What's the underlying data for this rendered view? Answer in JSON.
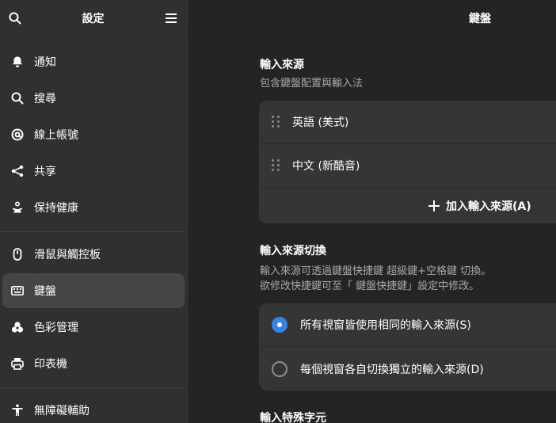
{
  "sidebar": {
    "title": "設定",
    "items": [
      {
        "label": "通知",
        "icon": "bell-icon"
      },
      {
        "label": "搜尋",
        "icon": "search-icon"
      },
      {
        "label": "線上帳號",
        "icon": "at-icon"
      },
      {
        "label": "共享",
        "icon": "share-icon"
      },
      {
        "label": "保持健康",
        "icon": "wellbeing-icon"
      },
      {
        "label": "滑鼠與觸控板",
        "icon": "mouse-icon"
      },
      {
        "label": "鍵盤",
        "icon": "keyboard-icon",
        "selected": true
      },
      {
        "label": "色彩管理",
        "icon": "color-icon"
      },
      {
        "label": "印表機",
        "icon": "printer-icon"
      },
      {
        "label": "無障礙輔助",
        "icon": "accessibility-icon"
      }
    ]
  },
  "main": {
    "title": "鍵盤",
    "input_sources": {
      "title": "輸入來源",
      "subtitle": "包含鍵盤配置與輸入法",
      "items": [
        "英語 (美式)",
        "中文 (新酷音)"
      ],
      "add_label": "加入輸入來源(A)"
    },
    "switching": {
      "title": "輸入來源切換",
      "subtitle_line1": "輸入來源可透過鍵盤快捷鍵 超級鍵+空格鍵 切換。",
      "subtitle_line2": "欲修改快捷鍵可至「 鍵盤快捷鍵」設定中修改。",
      "options": [
        "所有視窗皆使用相同的輸入來源(S)",
        "每個視窗各自切換獨立的輸入來源(D)"
      ],
      "selected_index": 0
    },
    "special_chars": {
      "title": "輸入特殊字元"
    }
  },
  "colors": {
    "accent": "#3584e4",
    "sidebar_bg": "#303030",
    "main_bg": "#242424",
    "card_bg": "#353535"
  }
}
